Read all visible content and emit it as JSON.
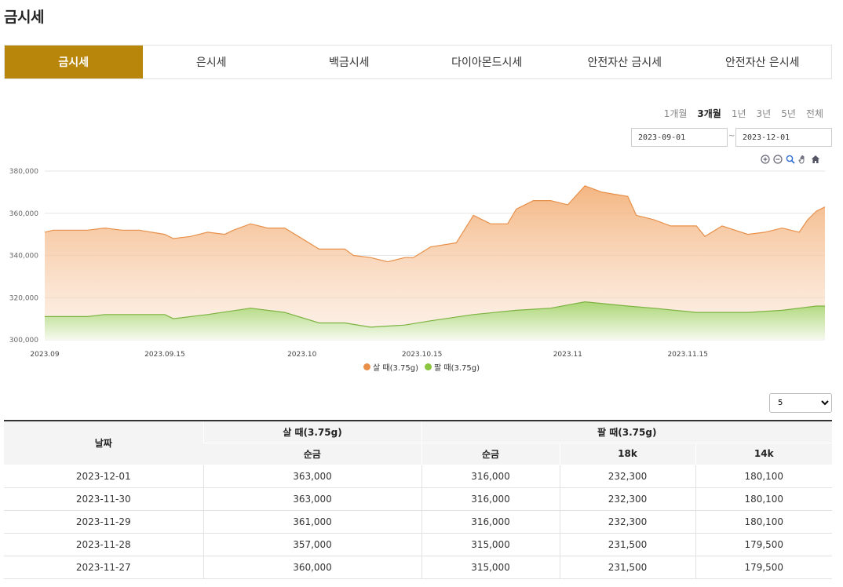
{
  "page": {
    "title": "금시세"
  },
  "tabs": [
    {
      "label": "금시세",
      "active": true
    },
    {
      "label": "은시세",
      "active": false
    },
    {
      "label": "백금시세",
      "active": false
    },
    {
      "label": "다이아몬드시세",
      "active": false
    },
    {
      "label": "안전자산 금시세",
      "active": false
    },
    {
      "label": "안전자산 은시세",
      "active": false
    }
  ],
  "periods": [
    {
      "label": "1개월",
      "active": false
    },
    {
      "label": "3개월",
      "active": true
    },
    {
      "label": "1년",
      "active": false
    },
    {
      "label": "3년",
      "active": false
    },
    {
      "label": "5년",
      "active": false
    },
    {
      "label": "전체",
      "active": false
    }
  ],
  "date_range": {
    "start": "2023-09-01",
    "end": "2023-12-01",
    "separator": "~"
  },
  "toolbar_icons": [
    "zoom-in-icon",
    "zoom-out-icon",
    "magnify-icon",
    "pan-hand-icon",
    "home-icon"
  ],
  "rows_select": {
    "value": "5"
  },
  "colors": {
    "buy": "#f0a060",
    "sell": "#8cc63f",
    "buy_line": "#e8904a",
    "sell_line": "#7cb342",
    "tab_active": "#b8860b"
  },
  "chart_data": {
    "type": "area",
    "x_ticks": [
      "2023.09",
      "2023.09.15",
      "2023.10",
      "2023.10.15",
      "2023.11",
      "2023.11.15"
    ],
    "ylim": [
      300000,
      380000
    ],
    "y_ticks": [
      "380,000",
      "360,000",
      "340,000",
      "320,000",
      "300,000"
    ],
    "y_tick_values": [
      380000,
      360000,
      340000,
      320000,
      300000
    ],
    "x_start": "2023-09-01",
    "x_end": "2023-12-01",
    "series": [
      {
        "name": "살 때(3.75g)",
        "dates": [
          "2023-09-01",
          "2023-09-02",
          "2023-09-06",
          "2023-09-08",
          "2023-09-10",
          "2023-09-12",
          "2023-09-15",
          "2023-09-16",
          "2023-09-18",
          "2023-09-20",
          "2023-09-22",
          "2023-09-23",
          "2023-09-25",
          "2023-09-27",
          "2023-09-29",
          "2023-10-03",
          "2023-10-06",
          "2023-10-07",
          "2023-10-09",
          "2023-10-11",
          "2023-10-13",
          "2023-10-14",
          "2023-10-16",
          "2023-10-19",
          "2023-10-21",
          "2023-10-23",
          "2023-10-25",
          "2023-10-26",
          "2023-10-28",
          "2023-10-30",
          "2023-11-01",
          "2023-11-03",
          "2023-11-05",
          "2023-11-08",
          "2023-11-09",
          "2023-11-10",
          "2023-11-11",
          "2023-11-13",
          "2023-11-16",
          "2023-11-17",
          "2023-11-19",
          "2023-11-22",
          "2023-11-24",
          "2023-11-26",
          "2023-11-28",
          "2023-11-29",
          "2023-11-30",
          "2023-12-01"
        ],
        "values": [
          351000,
          352000,
          352000,
          353000,
          352000,
          352000,
          350000,
          348000,
          349000,
          351000,
          350000,
          352000,
          355000,
          353000,
          353000,
          343000,
          343000,
          340000,
          339000,
          337000,
          339000,
          339000,
          344000,
          346000,
          359000,
          355000,
          355000,
          362000,
          366000,
          366000,
          364000,
          373000,
          370000,
          368000,
          359000,
          358000,
          357000,
          354000,
          354000,
          349000,
          354000,
          350000,
          351000,
          353000,
          351000,
          357000,
          361000,
          363000
        ]
      },
      {
        "name": "팔 때(3.75g)",
        "dates": [
          "2023-09-01",
          "2023-09-06",
          "2023-09-08",
          "2023-09-15",
          "2023-09-16",
          "2023-09-20",
          "2023-09-25",
          "2023-09-29",
          "2023-10-03",
          "2023-10-06",
          "2023-10-09",
          "2023-10-13",
          "2023-10-16",
          "2023-10-21",
          "2023-10-26",
          "2023-10-30",
          "2023-11-03",
          "2023-11-08",
          "2023-11-11",
          "2023-11-16",
          "2023-11-22",
          "2023-11-26",
          "2023-11-28",
          "2023-11-30",
          "2023-12-01"
        ],
        "values": [
          311000,
          311000,
          312000,
          312000,
          310000,
          312000,
          315000,
          313000,
          308000,
          308000,
          306000,
          307000,
          309000,
          312000,
          314000,
          315000,
          318000,
          316000,
          315000,
          313000,
          313000,
          314000,
          315000,
          316000,
          316000
        ]
      }
    ]
  },
  "table": {
    "group_headers": {
      "date": "날짜",
      "buy": "살 때(3.75g)",
      "sell": "팔 때(3.75g)"
    },
    "sub_headers": {
      "buy_pure": "순금",
      "sell_pure": "순금",
      "sell_18k": "18k",
      "sell_14k": "14k"
    },
    "rows": [
      {
        "date": "2023-12-01",
        "buy_pure": "363,000",
        "sell_pure": "316,000",
        "sell_18k": "232,300",
        "sell_14k": "180,100"
      },
      {
        "date": "2023-11-30",
        "buy_pure": "363,000",
        "sell_pure": "316,000",
        "sell_18k": "232,300",
        "sell_14k": "180,100"
      },
      {
        "date": "2023-11-29",
        "buy_pure": "361,000",
        "sell_pure": "316,000",
        "sell_18k": "232,300",
        "sell_14k": "180,100"
      },
      {
        "date": "2023-11-28",
        "buy_pure": "357,000",
        "sell_pure": "315,000",
        "sell_18k": "231,500",
        "sell_14k": "179,500"
      },
      {
        "date": "2023-11-27",
        "buy_pure": "360,000",
        "sell_pure": "315,000",
        "sell_18k": "231,500",
        "sell_14k": "179,500"
      }
    ]
  }
}
